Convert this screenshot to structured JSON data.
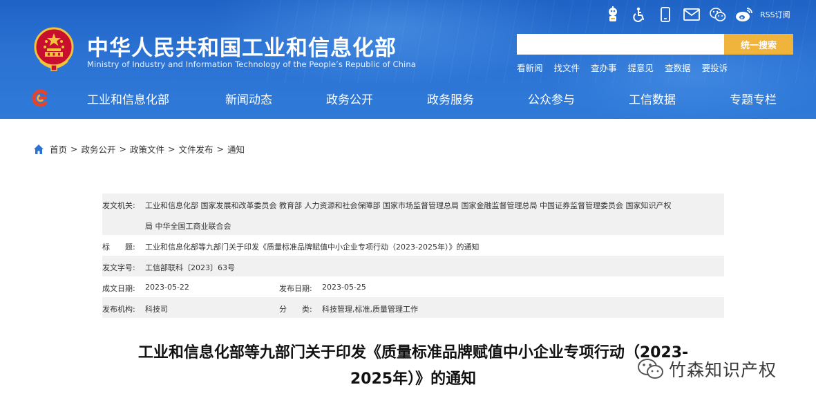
{
  "header": {
    "title_cn": "中华人民共和国工业和信息化部",
    "title_en": "Ministry of Industry and Information Technology of the People’s Republic of China",
    "rss_label": "RSS订阅",
    "search_placeholder": "",
    "search_button": "统一搜索",
    "quick_links": [
      "看新闻",
      "找文件",
      "查办事",
      "提意见",
      "查数据",
      "要投诉"
    ],
    "icons": [
      "robot-assistant-icon",
      "accessibility-icon",
      "mobile-icon",
      "mail-icon",
      "wechat-icon",
      "weibo-icon"
    ]
  },
  "nav": {
    "items": [
      "工业和信息化部",
      "新闻动态",
      "政务公开",
      "政务服务",
      "公众参与",
      "工信数据",
      "专题专栏"
    ]
  },
  "breadcrumb": {
    "items": [
      "首页",
      "政务公开",
      "政策文件",
      "文件发布",
      "通知"
    ],
    "separator": ">"
  },
  "meta": {
    "issuer_label": "发文机关:",
    "issuer_line1": "工业和信息化部 国家发展和改革委员会 教育部 人力资源和社会保障部 国家市场监督管理总局 国家金融监督管理总局 中国证券监督管理委员会 国家知识产权",
    "issuer_line2": "局 中华全国工商业联合会",
    "title_label": "标　　题:",
    "title_value": "工业和信息化部等九部门关于印发《质量标准品牌赋值中小企业专项行动（2023-2025年）》的通知",
    "docno_label": "发文字号:",
    "docno_value": "工信部联科〔2023〕63号",
    "created_label": "成文日期:",
    "created_value": "2023-05-22",
    "published_label": "发布日期:",
    "published_value": "2023-05-25",
    "org_label": "发布机构:",
    "org_value": "科技司",
    "category_label": "分　　类:",
    "category_value": "科技管理,标准,质量管理工作"
  },
  "article": {
    "title_line1": "工业和信息化部等九部门关于印发《质量标准品牌赋值中小企业专项行动（2023-",
    "title_line2": "2025年）》的通知"
  },
  "watermark": {
    "text": "竹森知识产权"
  },
  "colors": {
    "header_blue": "#2b72d3",
    "search_button": "#f0b33c",
    "meta_row_gray": "#f1f1f1"
  }
}
